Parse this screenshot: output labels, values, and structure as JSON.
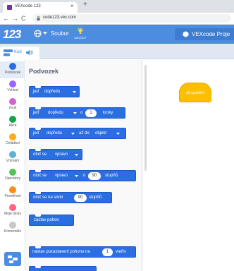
{
  "browser": {
    "tab_title": "VEXcode 123",
    "new_tab": "+",
    "close_tab": "×",
    "url": "code123.vex.com"
  },
  "header": {
    "logo": "123",
    "file_menu": "Soubor",
    "tips_label": "NÁVODY",
    "project_name": "VEXcode Proje"
  },
  "editor_tabs": {
    "code_label": "Kód"
  },
  "categories": [
    {
      "label": "Podvozek",
      "color": "#2b6ee2"
    },
    {
      "label": "Vzhled",
      "color": "#9966ff"
    },
    {
      "label": "Zvuk",
      "color": "#cf63cf"
    },
    {
      "label": "Akce",
      "color": "#16a34a"
    },
    {
      "label": "Ovládání",
      "color": "#ffab19"
    },
    {
      "label": "Vnímání",
      "color": "#5cb1d6"
    },
    {
      "label": "Operátory",
      "color": "#59c059"
    },
    {
      "label": "Proměnné",
      "color": "#ff8c1a"
    },
    {
      "label": "Moje bloky",
      "color": "#ff6680"
    },
    {
      "label": "Komentáře",
      "color": "#c8c8c8"
    }
  ],
  "palette": {
    "title": "Podvozek",
    "blocks": {
      "b1": {
        "text1": "jeď",
        "text2": "dopředu"
      },
      "b2": {
        "text1": "jeď",
        "text2": "dopředu",
        "text3": "o",
        "value": "1",
        "text4": "kroky"
      },
      "b3": {
        "text1": "jeď",
        "text2": "dopředu",
        "text3": "až do",
        "text4": "objekt"
      },
      "b4": {
        "text1": "otoč se",
        "text2": "vpravo"
      },
      "b5": {
        "text1": "otoč se",
        "text2": "vpravo",
        "text3": "o",
        "value": "90",
        "text4": "stupňů"
      },
      "b6": {
        "text1": "otoč se na směr",
        "value": "90",
        "text2": "stupňů"
      },
      "b7": {
        "text1": "zastav pohon"
      },
      "b8": {
        "text1": "nastav pozastavení pohonu na",
        "value": "1",
        "text2": "vteřin"
      }
    }
  },
  "workspace": {
    "hat_block": "při spuštění"
  }
}
